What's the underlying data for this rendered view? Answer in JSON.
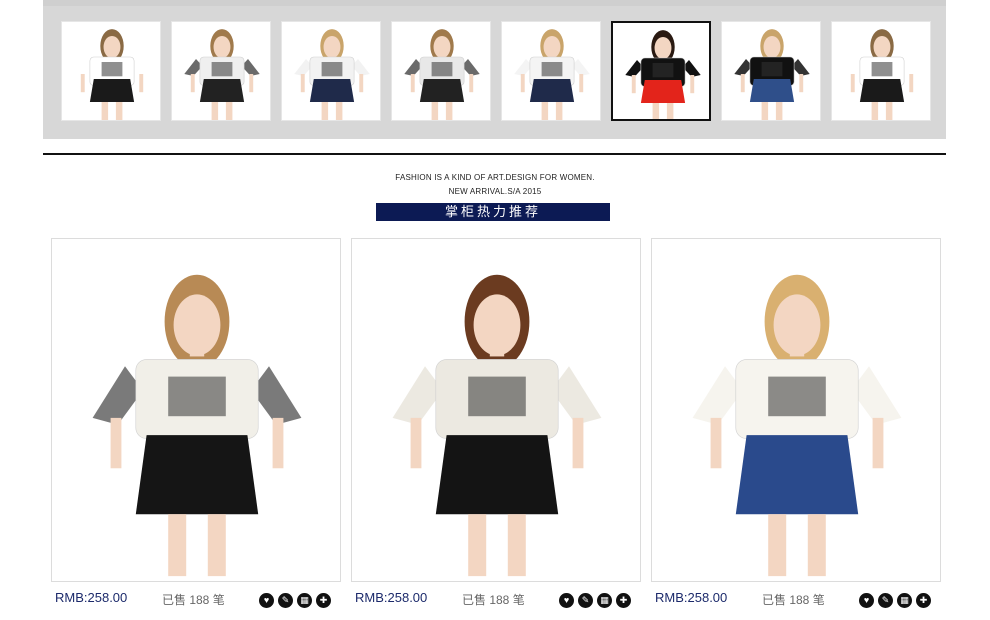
{
  "thumbnails": [
    {
      "top_color": "#ffffff",
      "bottom_color": "#1a1a1a",
      "hair": "#8a6a44",
      "sleeve": "#ffffff"
    },
    {
      "top_color": "#efefef",
      "bottom_color": "#222222",
      "hair": "#a07a4c",
      "sleeve": "#6a6a6a"
    },
    {
      "top_color": "#f2f2f2",
      "bottom_color": "#1f2a4a",
      "hair": "#c9a46a",
      "sleeve": "#f2f2f2"
    },
    {
      "top_color": "#e8e8e8",
      "bottom_color": "#222222",
      "hair": "#a07a4c",
      "sleeve": "#6a6a6a"
    },
    {
      "top_color": "#f4f4f4",
      "bottom_color": "#1f2a4a",
      "hair": "#c9a46a",
      "sleeve": "#f4f4f4"
    },
    {
      "top_color": "#111111",
      "bottom_color": "#e3241b",
      "hair": "#2a1a12",
      "sleeve": "#111111"
    },
    {
      "top_color": "#111111",
      "bottom_color": "#2f4f8a",
      "hair": "#c9a46a",
      "sleeve": "#333333"
    },
    {
      "top_color": "#ffffff",
      "bottom_color": "#1a1a1a",
      "hair": "#8a6a44",
      "sleeve": "#ffffff"
    }
  ],
  "active_thumbnail": 5,
  "tagline": {
    "line1": "FASHION IS A KIND OF ART.DESIGN FOR WOMEN.",
    "line2": "NEW ARRIVAL.S/A 2015"
  },
  "banner": {
    "label": "掌柜热力推荐"
  },
  "products": [
    {
      "price": "RMB:258.00",
      "sold": "已售 188 笔",
      "top_color": "#f1efe8",
      "sleeve": "#7a7a7a",
      "bottom_color": "#151515",
      "hair": "#b88a55"
    },
    {
      "price": "RMB:258.00",
      "sold": "已售 188 笔",
      "top_color": "#ece9e1",
      "sleeve": "#ece9e1",
      "bottom_color": "#141414",
      "hair": "#6b3b20"
    },
    {
      "price": "RMB:258.00",
      "sold": "已售 188 笔",
      "top_color": "#f6f4ee",
      "sleeve": "#f6f4ee",
      "bottom_color": "#2a4a8c",
      "hair": "#d9b070"
    }
  ],
  "actions": [
    {
      "name": "favorite",
      "glyph": "♥"
    },
    {
      "name": "tag",
      "glyph": "✎"
    },
    {
      "name": "qr",
      "glyph": "▦"
    },
    {
      "name": "cart",
      "glyph": "✚"
    }
  ]
}
